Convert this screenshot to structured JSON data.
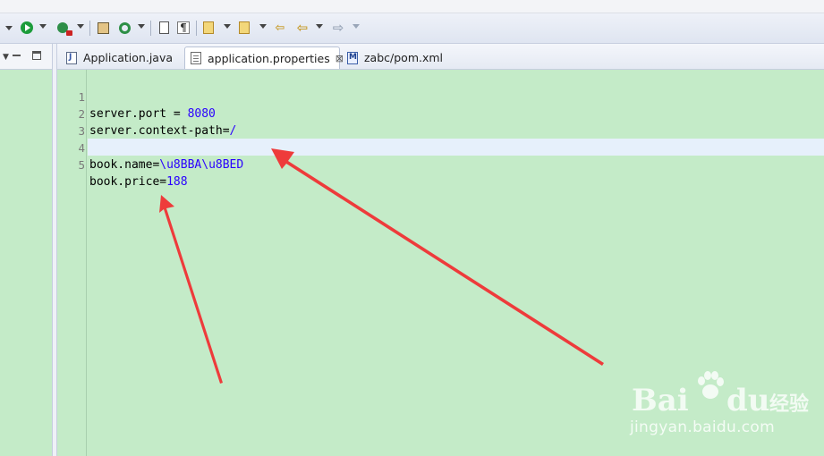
{
  "tabs": [
    {
      "label": "Application.java",
      "icon": "java-file-icon",
      "active": false
    },
    {
      "label": "application.properties",
      "icon": "properties-file-icon",
      "active": true,
      "close_glyph": "⊠"
    },
    {
      "label": "zabc/pom.xml",
      "icon": "maven-pom-icon",
      "active": false
    }
  ],
  "editor": {
    "lines": [
      {
        "number": "1",
        "key": "server.port = ",
        "value": "8080"
      },
      {
        "number": "2",
        "key": "server.context-path=",
        "value": "/"
      },
      {
        "number": "3",
        "key": "",
        "value": ""
      },
      {
        "number": "4",
        "key": "book.name=",
        "value": "\\u8BBA\\u8BED"
      },
      {
        "number": "5",
        "key": "book.price=",
        "value": "188"
      }
    ],
    "current_line": 5
  },
  "watermark": {
    "brand_left": "Bai",
    "brand_right": "du",
    "brand_suffix": "经验",
    "url": "jingyan.baidu.com"
  },
  "colors": {
    "editor_background": "#c4ebc8",
    "value_text": "#2a00ff",
    "annotation_arrow": "#ee3b3b",
    "current_line": "#e6f0fb"
  }
}
